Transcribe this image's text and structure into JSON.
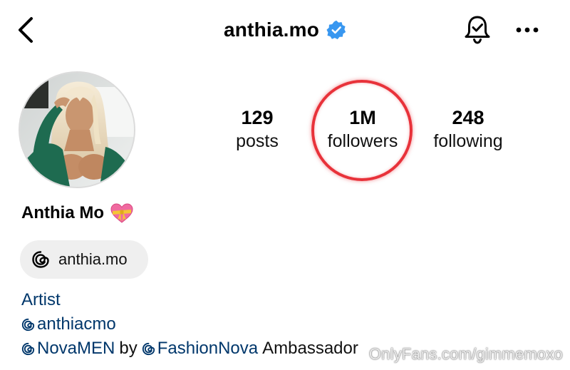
{
  "header": {
    "username": "anthia.mo"
  },
  "stats": {
    "posts": {
      "value": "129",
      "label": "posts"
    },
    "followers": {
      "value": "1M",
      "label": "followers"
    },
    "following": {
      "value": "248",
      "label": "following"
    }
  },
  "profile": {
    "display_name": "Anthia Mo",
    "name_emoji": "heart-with-ribbon-emoji",
    "threads_handle": "anthia.mo"
  },
  "bio": {
    "line1": "Artist",
    "line2_mention": "anthiacmo",
    "line3_mention1": "NovaMEN",
    "line3_by": "by",
    "line3_mention2": "FashionNova",
    "line3_tail": "Ambassador"
  },
  "watermark": "OnlyFans.com/gimmemoxo",
  "colors": {
    "verified_blue": "#3897f0",
    "link_blue": "#00376b",
    "highlight_red": "#e8323a",
    "pill_bg": "#efefef"
  },
  "icons": [
    "back-chevron-icon",
    "verified-badge-icon",
    "bell-check-icon",
    "more-dots-icon",
    "threads-logo-icon"
  ]
}
